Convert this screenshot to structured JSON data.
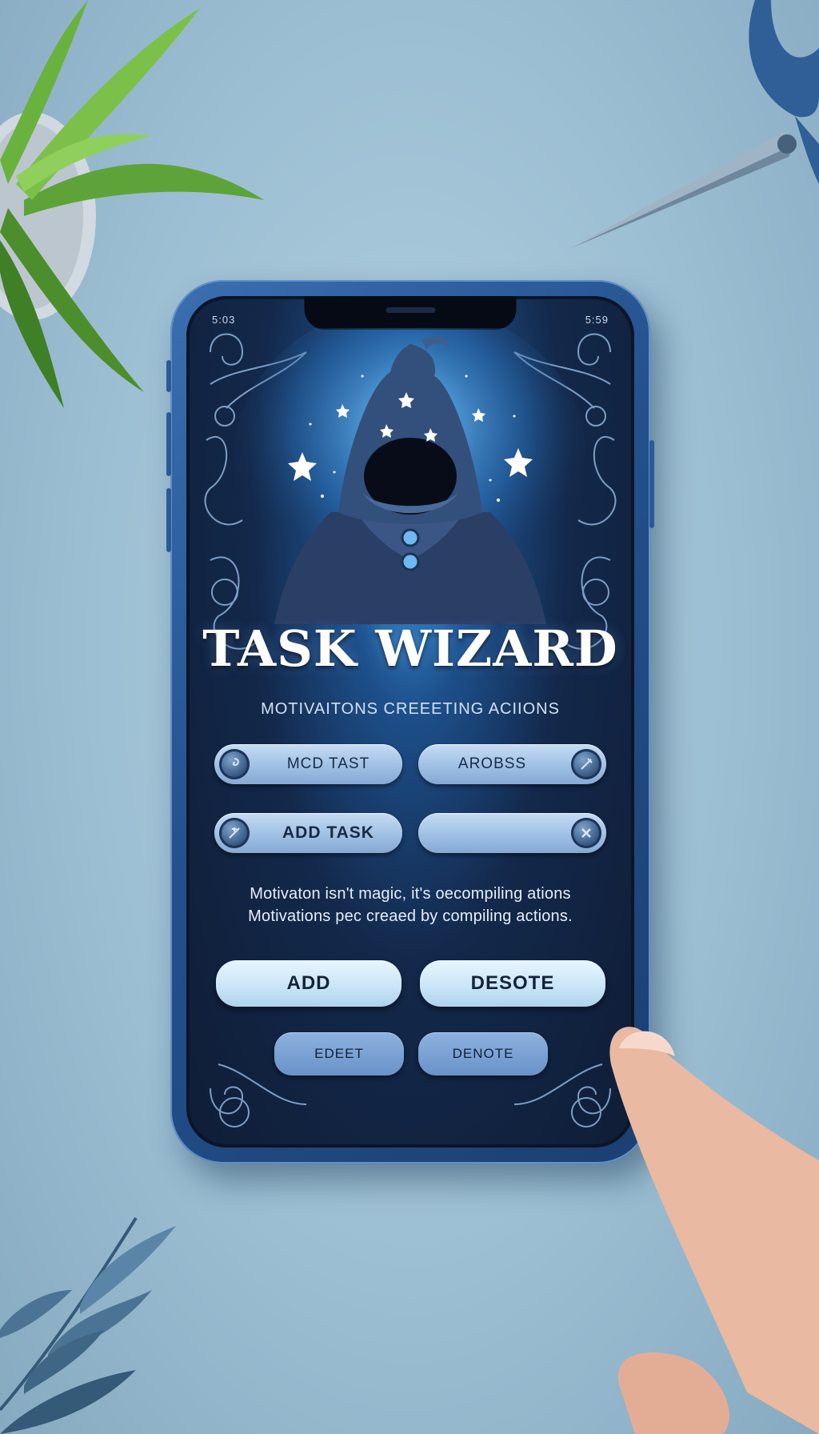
{
  "status_bar": {
    "left": "5:03",
    "right": "5:59"
  },
  "app": {
    "title": "TASK WIZARD",
    "subtitle": "MOTIVAITONS CREEETING ACIIONS"
  },
  "row1": [
    {
      "label": "MCD TAST",
      "icon": "swirl-icon"
    },
    {
      "label": "AROBSS",
      "icon": "wand-icon"
    }
  ],
  "row2": [
    {
      "label": "ADD TASK",
      "icon": "wand-icon"
    },
    {
      "label": "",
      "icon": "close-icon"
    }
  ],
  "quote": {
    "line1": "Motivaton isn't magic, it's oecompiling ations",
    "line2": "Motivations pec creaed by compiling actions."
  },
  "actions": {
    "add": "ADD",
    "delete": "DESOTE"
  },
  "footer": {
    "edit": "EDEET",
    "delete": "DENOTE"
  },
  "colors": {
    "accent": "#3e9ee0",
    "screen_bg": "#13284a",
    "button": "#9fc0e4"
  }
}
